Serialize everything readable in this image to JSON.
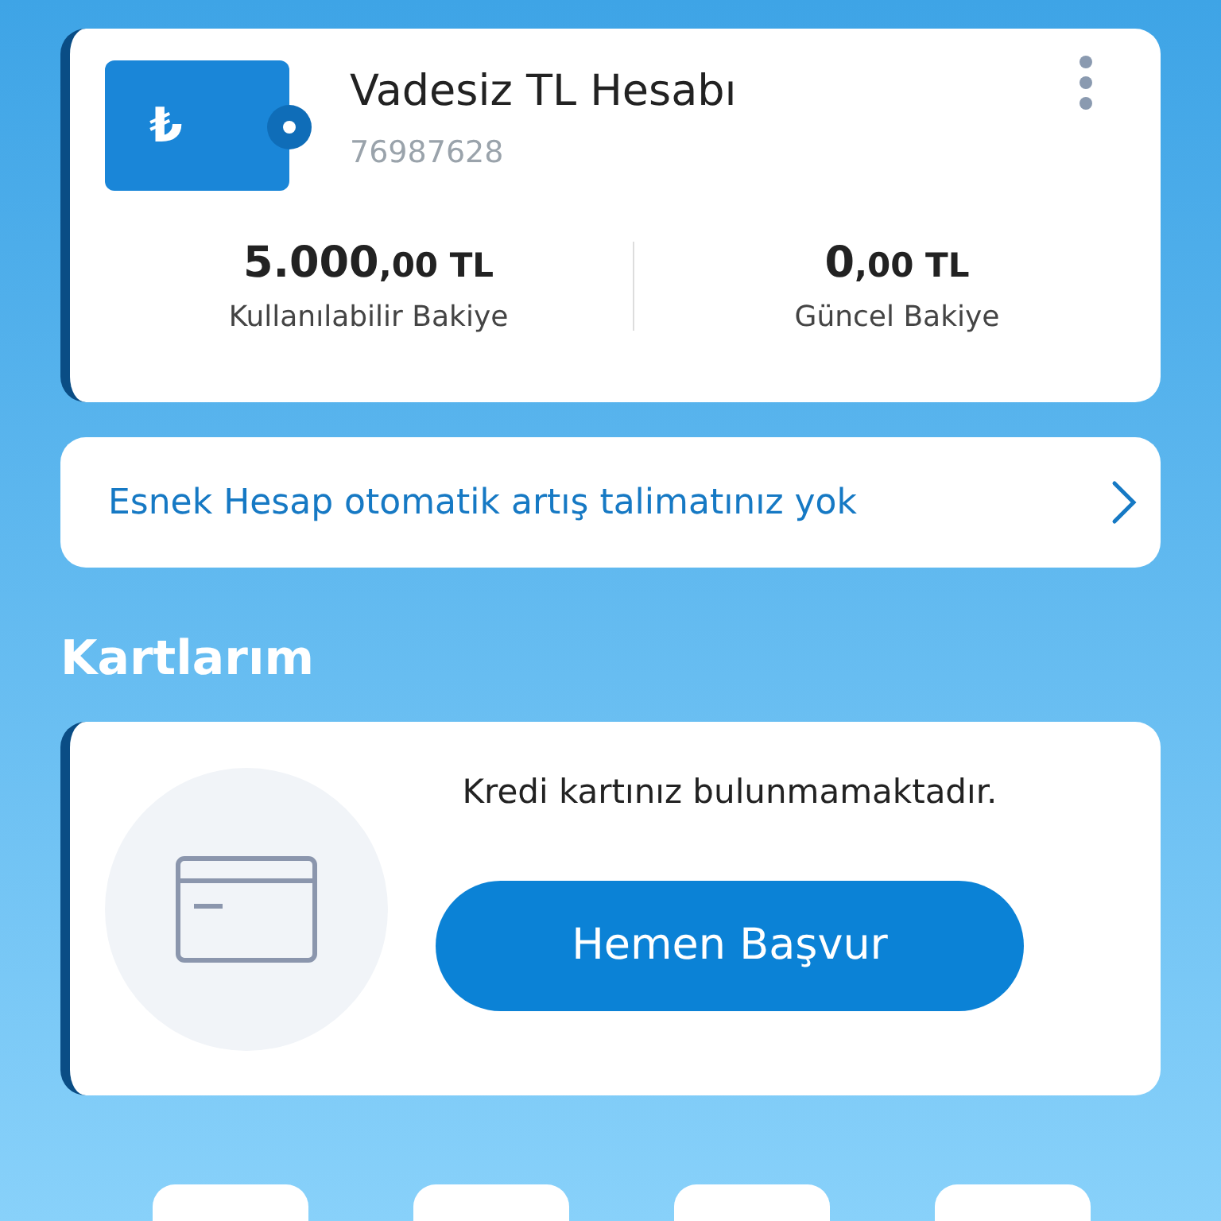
{
  "account": {
    "currency_symbol": "₺",
    "name": "Vadesiz TL Hesabı",
    "number": "76987628",
    "balances": [
      {
        "main": "5.000",
        "rest": ",00 TL",
        "label": "Kullanılabilir Bakiye"
      },
      {
        "main": "0",
        "rest": ",00 TL",
        "label": "Güncel Bakiye"
      }
    ]
  },
  "notice": {
    "text": "Esnek Hesap otomatik artış talimatınız yok"
  },
  "cards_section": {
    "title": "Kartlarım",
    "message": "Kredi kartınız bulunmamaktadır.",
    "button": "Hemen Başvur"
  },
  "shortcuts": [
    {
      "kind": "tile"
    },
    {
      "kind": "tile"
    },
    {
      "kind": "tile"
    },
    {
      "kind": "tile"
    }
  ]
}
